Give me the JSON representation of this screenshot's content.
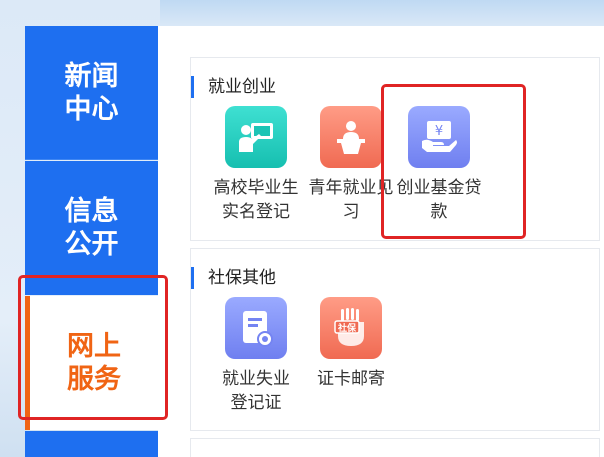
{
  "nav": {
    "news": "新闻\n中心",
    "info": "信息\n公开",
    "online": "网上\n服务"
  },
  "sections": [
    {
      "title": "就业创业",
      "items": [
        {
          "label": "高校毕业生\n实名登记",
          "icon": "presenter-board-icon",
          "color": "#26cfc0"
        },
        {
          "label": "青年就业见\n习",
          "icon": "podium-speaker-icon",
          "color": "#f47c64"
        },
        {
          "label": "创业基金贷\n款",
          "icon": "yen-loan-icon",
          "color": "#8494fb"
        }
      ]
    },
    {
      "title": "社保其他",
      "items": [
        {
          "label": "就业失业\n登记证",
          "icon": "certificate-icon",
          "color": "#8494fb"
        },
        {
          "label": "证卡邮寄",
          "icon": "social-card-mail-icon",
          "color": "#f47c64"
        }
      ]
    }
  ],
  "icon_text": {
    "yen": "¥",
    "shebao": "社保"
  },
  "colors": {
    "nav_blue": "#1e6ff0",
    "active_orange": "#f06414",
    "highlight_red": "#e02424"
  }
}
